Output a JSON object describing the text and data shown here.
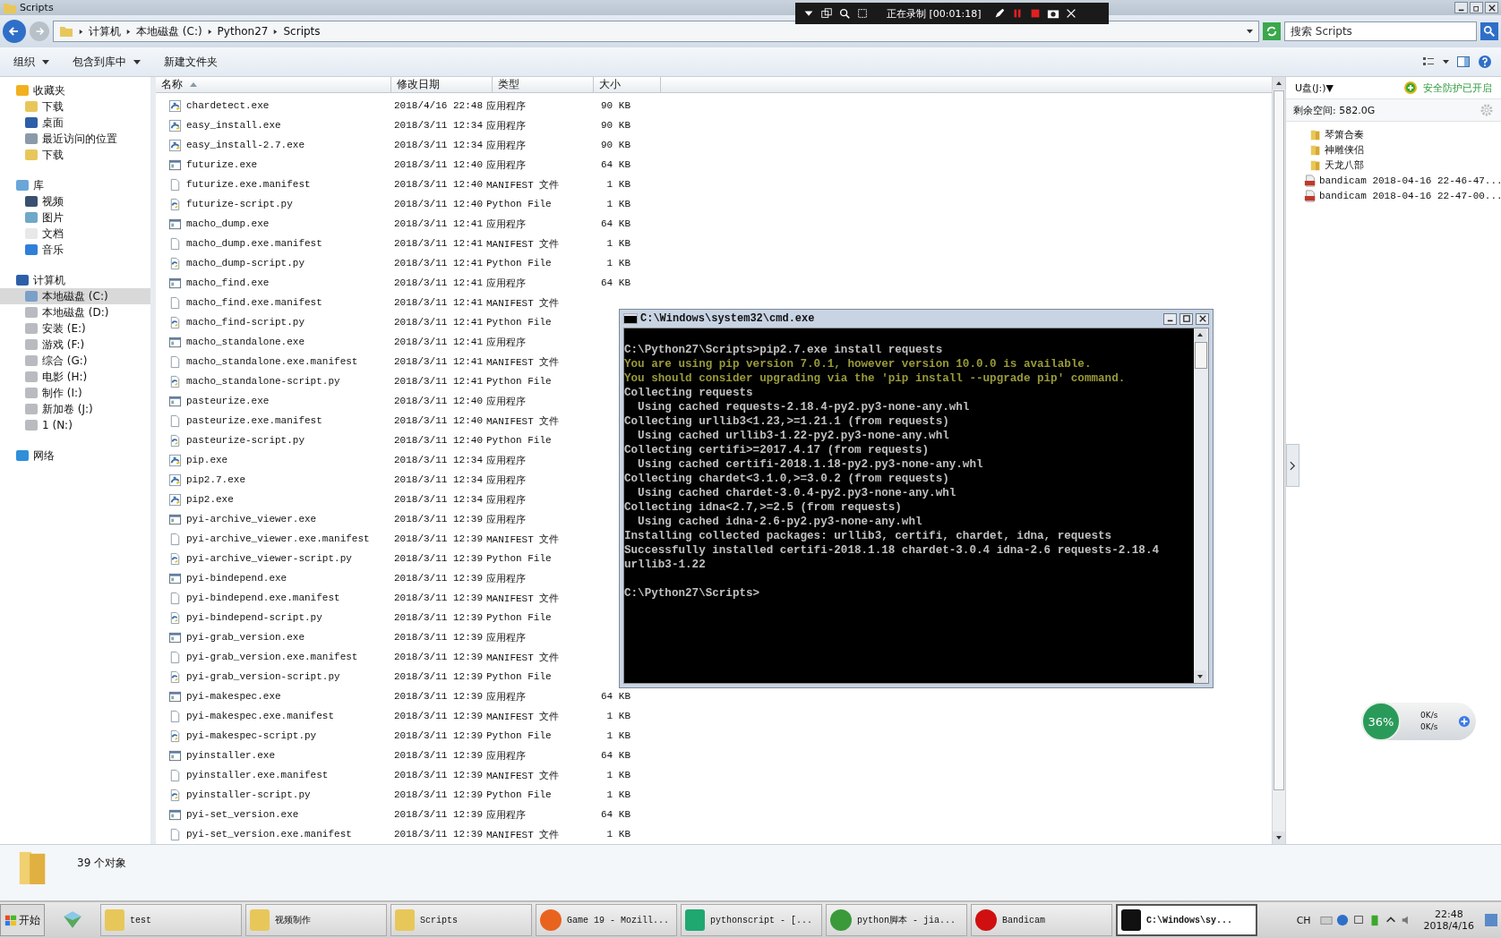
{
  "window": {
    "title": "Scripts"
  },
  "recorder": {
    "status": "正在录制 [00:01:18]"
  },
  "address": {
    "crumbs": [
      "计算机",
      "本地磁盘 (C:)",
      "Python27",
      "Scripts"
    ]
  },
  "search": {
    "placeholder": "搜索 Scripts"
  },
  "toolbar": {
    "buttons": [
      {
        "label": "组织",
        "dropdown": true
      },
      {
        "label": "包含到库中",
        "dropdown": true
      },
      {
        "label": "新建文件夹",
        "dropdown": false
      }
    ]
  },
  "sidebar": [
    {
      "label": "收藏夹",
      "kind": "star",
      "children": [
        {
          "label": "下载",
          "kind": "download",
          "selected": false
        },
        {
          "label": "桌面",
          "kind": "desktop",
          "selected": false
        },
        {
          "label": "最近访问的位置",
          "kind": "recent",
          "selected": false
        },
        {
          "label": "下载",
          "kind": "download",
          "selected": false
        }
      ]
    },
    {
      "label": "库",
      "kind": "library",
      "children": [
        {
          "label": "视频",
          "kind": "video",
          "selected": false
        },
        {
          "label": "图片",
          "kind": "image",
          "selected": false
        },
        {
          "label": "文档",
          "kind": "document",
          "selected": false
        },
        {
          "label": "音乐",
          "kind": "music",
          "selected": false
        }
      ]
    },
    {
      "label": "计算机",
      "kind": "computer",
      "children": [
        {
          "label": "本地磁盘 (C:)",
          "kind": "sysdrive",
          "selected": true
        },
        {
          "label": "本地磁盘 (D:)",
          "kind": "drive",
          "selected": false
        },
        {
          "label": "安装 (E:)",
          "kind": "drive",
          "selected": false
        },
        {
          "label": "游戏 (F:)",
          "kind": "drive",
          "selected": false
        },
        {
          "label": "综合 (G:)",
          "kind": "drive",
          "selected": false
        },
        {
          "label": "电影 (H:)",
          "kind": "drive",
          "selected": false
        },
        {
          "label": "制作 (I:)",
          "kind": "drive",
          "selected": false
        },
        {
          "label": "新加卷 (J:)",
          "kind": "drive",
          "selected": false
        },
        {
          "label": "1 (N:)",
          "kind": "drive",
          "selected": false
        }
      ]
    },
    {
      "label": "网络",
      "kind": "network"
    }
  ],
  "table": {
    "columns": [
      {
        "label": "名称",
        "sorted": true
      },
      {
        "label": "修改日期",
        "sorted": false
      },
      {
        "label": "类型",
        "sorted": false
      },
      {
        "label": "大小",
        "sorted": false
      }
    ],
    "rows": [
      {
        "kind": "pyexe",
        "name": "chardetect.exe",
        "date": "2018/4/16 22:48",
        "type": "应用程序",
        "size": "90 KB"
      },
      {
        "kind": "pyexe",
        "name": "easy_install.exe",
        "date": "2018/3/11 12:34",
        "type": "应用程序",
        "size": "90 KB"
      },
      {
        "kind": "pyexe",
        "name": "easy_install-2.7.exe",
        "date": "2018/3/11 12:34",
        "type": "应用程序",
        "size": "90 KB"
      },
      {
        "kind": "exe",
        "name": "futurize.exe",
        "date": "2018/3/11 12:40",
        "type": "应用程序",
        "size": "64 KB"
      },
      {
        "kind": "manifest",
        "name": "futurize.exe.manifest",
        "date": "2018/3/11 12:40",
        "type": "MANIFEST 文件",
        "size": "1 KB"
      },
      {
        "kind": "script",
        "name": "futurize-script.py",
        "date": "2018/3/11 12:40",
        "type": "Python File",
        "size": "1 KB"
      },
      {
        "kind": "exe",
        "name": "macho_dump.exe",
        "date": "2018/3/11 12:41",
        "type": "应用程序",
        "size": "64 KB"
      },
      {
        "kind": "manifest",
        "name": "macho_dump.exe.manifest",
        "date": "2018/3/11 12:41",
        "type": "MANIFEST 文件",
        "size": "1 KB"
      },
      {
        "kind": "script",
        "name": "macho_dump-script.py",
        "date": "2018/3/11 12:41",
        "type": "Python File",
        "size": "1 KB"
      },
      {
        "kind": "exe",
        "name": "macho_find.exe",
        "date": "2018/3/11 12:41",
        "type": "应用程序",
        "size": "64 KB"
      },
      {
        "kind": "manifest",
        "name": "macho_find.exe.manifest",
        "date": "2018/3/11 12:41",
        "type": "MANIFEST 文件"
      },
      {
        "kind": "script",
        "name": "macho_find-script.py",
        "date": "2018/3/11 12:41",
        "type": "Python File"
      },
      {
        "kind": "exe",
        "name": "macho_standalone.exe",
        "date": "2018/3/11 12:41",
        "type": "应用程序"
      },
      {
        "kind": "manifest",
        "name": "macho_standalone.exe.manifest",
        "date": "2018/3/11 12:41",
        "type": "MANIFEST 文件"
      },
      {
        "kind": "script",
        "name": "macho_standalone-script.py",
        "date": "2018/3/11 12:41",
        "type": "Python File"
      },
      {
        "kind": "exe",
        "name": "pasteurize.exe",
        "date": "2018/3/11 12:40",
        "type": "应用程序"
      },
      {
        "kind": "manifest",
        "name": "pasteurize.exe.manifest",
        "date": "2018/3/11 12:40",
        "type": "MANIFEST 文件"
      },
      {
        "kind": "script",
        "name": "pasteurize-script.py",
        "date": "2018/3/11 12:40",
        "type": "Python File"
      },
      {
        "kind": "pyexe",
        "name": "pip.exe",
        "date": "2018/3/11 12:34",
        "type": "应用程序"
      },
      {
        "kind": "pyexe",
        "name": "pip2.7.exe",
        "date": "2018/3/11 12:34",
        "type": "应用程序"
      },
      {
        "kind": "pyexe",
        "name": "pip2.exe",
        "date": "2018/3/11 12:34",
        "type": "应用程序"
      },
      {
        "kind": "exe",
        "name": "pyi-archive_viewer.exe",
        "date": "2018/3/11 12:39",
        "type": "应用程序"
      },
      {
        "kind": "manifest",
        "name": "pyi-archive_viewer.exe.manifest",
        "date": "2018/3/11 12:39",
        "type": "MANIFEST 文件"
      },
      {
        "kind": "script",
        "name": "pyi-archive_viewer-script.py",
        "date": "2018/3/11 12:39",
        "type": "Python File"
      },
      {
        "kind": "exe",
        "name": "pyi-bindepend.exe",
        "date": "2018/3/11 12:39",
        "type": "应用程序"
      },
      {
        "kind": "manifest",
        "name": "pyi-bindepend.exe.manifest",
        "date": "2018/3/11 12:39",
        "type": "MANIFEST 文件"
      },
      {
        "kind": "script",
        "name": "pyi-bindepend-script.py",
        "date": "2018/3/11 12:39",
        "type": "Python File"
      },
      {
        "kind": "exe",
        "name": "pyi-grab_version.exe",
        "date": "2018/3/11 12:39",
        "type": "应用程序"
      },
      {
        "kind": "manifest",
        "name": "pyi-grab_version.exe.manifest",
        "date": "2018/3/11 12:39",
        "type": "MANIFEST 文件"
      },
      {
        "kind": "script",
        "name": "pyi-grab_version-script.py",
        "date": "2018/3/11 12:39",
        "type": "Python File"
      },
      {
        "kind": "exe",
        "name": "pyi-makespec.exe",
        "date": "2018/3/11 12:39",
        "type": "应用程序",
        "size": "64 KB"
      },
      {
        "kind": "manifest",
        "name": "pyi-makespec.exe.manifest",
        "date": "2018/3/11 12:39",
        "type": "MANIFEST 文件",
        "size": "1 KB"
      },
      {
        "kind": "script",
        "name": "pyi-makespec-script.py",
        "date": "2018/3/11 12:39",
        "type": "Python File",
        "size": "1 KB"
      },
      {
        "kind": "exe",
        "name": "pyinstaller.exe",
        "date": "2018/3/11 12:39",
        "type": "应用程序",
        "size": "64 KB"
      },
      {
        "kind": "manifest",
        "name": "pyinstaller.exe.manifest",
        "date": "2018/3/11 12:39",
        "type": "MANIFEST 文件",
        "size": "1 KB"
      },
      {
        "kind": "script",
        "name": "pyinstaller-script.py",
        "date": "2018/3/11 12:39",
        "type": "Python File",
        "size": "1 KB"
      },
      {
        "kind": "exe",
        "name": "pyi-set_version.exe",
        "date": "2018/3/11 12:39",
        "type": "应用程序",
        "size": "64 KB"
      },
      {
        "kind": "manifest",
        "name": "pyi-set_version.exe.manifest",
        "date": "2018/3/11 12:39",
        "type": "MANIFEST 文件",
        "size": "1 KB"
      }
    ]
  },
  "right_panel": {
    "drive": "U盘(J:)▼",
    "protection": "安全防护已开启",
    "free_space": "剩余空间: 582.0G",
    "items": [
      {
        "kind": "folder",
        "label": "琴箫合奏"
      },
      {
        "kind": "folder",
        "label": "神雕侠侣"
      },
      {
        "kind": "folder",
        "label": "天龙八部"
      },
      {
        "kind": "video",
        "label": "bandicam 2018-04-16 22-46-47..."
      },
      {
        "kind": "video",
        "label": "bandicam 2018-04-16 22-47-00..."
      }
    ]
  },
  "status_bar": {
    "count": "39 个对象"
  },
  "console": {
    "title": "C:\\Windows\\system32\\cmd.exe",
    "blocks": [
      {
        "lines": [
          {
            "kind": "normal",
            "text": "C:\\Python27\\Scripts>pip2.7.exe install requests"
          },
          {
            "kind": "warning",
            "text": "You are using pip version 7.0.1, however version 10.0.0 is available."
          },
          {
            "kind": "warning",
            "text": "You should consider upgrading via the 'pip install --upgrade pip' command."
          },
          {
            "kind": "normal",
            "text": "Collecting requests"
          },
          {
            "kind": "normal",
            "text": "  Using cached requests-2.18.4-py2.py3-none-any.whl"
          },
          {
            "kind": "normal",
            "text": "Collecting urllib3<1.23,>=1.21.1 (from requests)"
          },
          {
            "kind": "normal",
            "text": "  Using cached urllib3-1.22-py2.py3-none-any.whl"
          },
          {
            "kind": "normal",
            "text": "Collecting certifi>=2017.4.17 (from requests)"
          },
          {
            "kind": "normal",
            "text": "  Using cached certifi-2018.1.18-py2.py3-none-any.whl"
          },
          {
            "kind": "normal",
            "text": "Collecting chardet<3.1.0,>=3.0.2 (from requests)"
          },
          {
            "kind": "normal",
            "text": "  Using cached chardet-3.0.4-py2.py3-none-any.whl"
          },
          {
            "kind": "normal",
            "text": "Collecting idna<2.7,>=2.5 (from requests)"
          },
          {
            "kind": "normal",
            "text": "  Using cached idna-2.6-py2.py3-none-any.whl"
          },
          {
            "kind": "normal",
            "text": "Installing collected packages: urllib3, certifi, chardet, idna, requests"
          },
          {
            "kind": "normal",
            "text": "Successfully installed certifi-2018.1.18 chardet-3.0.4 idna-2.6 requests-2.18.4"
          },
          {
            "kind": "normal",
            "text": "urllib3-1.22"
          }
        ]
      },
      {
        "lines": [
          {
            "kind": "normal",
            "text": "C:\\Python27\\Scripts>"
          }
        ]
      }
    ]
  },
  "net_widget": {
    "percent": "36%",
    "upload": "0K/s",
    "download": "0K/s"
  },
  "taskbar": {
    "start": "开始",
    "items": [
      {
        "kind": "folder",
        "label": "test",
        "selected": false
      },
      {
        "kind": "folder",
        "label": "视频制作",
        "selected": false
      },
      {
        "kind": "folder",
        "label": "Scripts",
        "selected": false
      },
      {
        "kind": "firefox",
        "label": "Game 19 - Mozill...",
        "selected": false
      },
      {
        "kind": "pycharm",
        "label": "pythonscript - [...",
        "selected": false
      },
      {
        "kind": "evernote",
        "label": "python脚本 - jia...",
        "selected": false
      },
      {
        "kind": "record",
        "label": "Bandicam",
        "selected": false
      },
      {
        "kind": "console",
        "label": "C:\\Windows\\sy...",
        "selected": true
      }
    ],
    "language": "CH",
    "time": "22:48",
    "date": "2018/4/16"
  }
}
